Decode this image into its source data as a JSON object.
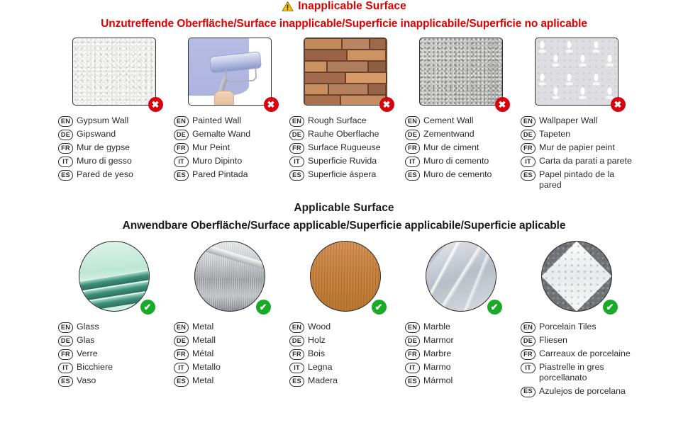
{
  "sections": {
    "inapplicable": {
      "title": "Inapplicable Surface",
      "subtitle": "Unzutreffende Oberfläche/Surface inapplicable/Superficie inapplicabile/Superficie no aplicable",
      "warning_icon": "warning-triangle-icon",
      "badge_symbol": "✖",
      "badge_color": "#d8000c",
      "title_color": "#e00000",
      "items": [
        {
          "media": "gypsum-wall-texture",
          "langs": [
            {
              "code": "EN",
              "text": "Gypsum Wall"
            },
            {
              "code": "DE",
              "text": "Gipswand"
            },
            {
              "code": "FR",
              "text": "Mur de gypse"
            },
            {
              "code": "IT",
              "text": "Muro di gesso"
            },
            {
              "code": "ES",
              "text": "Pared de yeso"
            }
          ]
        },
        {
          "media": "painted-wall-roller",
          "langs": [
            {
              "code": "EN",
              "text": "Painted Wall"
            },
            {
              "code": "DE",
              "text": "Gemalte Wand"
            },
            {
              "code": "FR",
              "text": "Mur Peint"
            },
            {
              "code": "IT",
              "text": "Muro Dipinto"
            },
            {
              "code": "ES",
              "text": "Pared Pintada"
            }
          ]
        },
        {
          "media": "rough-brick-surface",
          "langs": [
            {
              "code": "EN",
              "text": "Rough Surface"
            },
            {
              "code": "DE",
              "text": "Rauhe Oberflache"
            },
            {
              "code": "FR",
              "text": "Surface Rugueuse"
            },
            {
              "code": "IT",
              "text": "Superficie Ruvida"
            },
            {
              "code": "ES",
              "text": "Superficie áspera"
            }
          ]
        },
        {
          "media": "cement-wall-texture",
          "langs": [
            {
              "code": "EN",
              "text": "Cement Wall"
            },
            {
              "code": "DE",
              "text": "Zementwand"
            },
            {
              "code": "FR",
              "text": "Mur de ciment"
            },
            {
              "code": "IT",
              "text": "Muro di cemento"
            },
            {
              "code": "ES",
              "text": "Muro de cemento"
            }
          ]
        },
        {
          "media": "wallpaper-damask-texture",
          "langs": [
            {
              "code": "EN",
              "text": "Wallpaper Wall"
            },
            {
              "code": "DE",
              "text": "Tapeten"
            },
            {
              "code": "FR",
              "text": "Mur de papier peint"
            },
            {
              "code": "IT",
              "text": "Carta da parati a parete"
            },
            {
              "code": "ES",
              "text": "Papel pintado de la pared"
            }
          ]
        }
      ]
    },
    "applicable": {
      "title": "Applicable Surface",
      "subtitle": "Anwendbare Oberfläche/Surface applicable/Superficie applicabile/Superficie aplicable",
      "badge_symbol": "✔",
      "badge_color": "#17ab27",
      "title_color": "#1a1a1a",
      "items": [
        {
          "media": "glass-panes",
          "langs": [
            {
              "code": "EN",
              "text": "Glass"
            },
            {
              "code": "DE",
              "text": "Glas"
            },
            {
              "code": "FR",
              "text": "Verre"
            },
            {
              "code": "IT",
              "text": "Bicchiere"
            },
            {
              "code": "ES",
              "text": "Vaso"
            }
          ]
        },
        {
          "media": "brushed-metal",
          "langs": [
            {
              "code": "EN",
              "text": "Metal"
            },
            {
              "code": "DE",
              "text": "Metall"
            },
            {
              "code": "FR",
              "text": "Métal"
            },
            {
              "code": "IT",
              "text": "Metallo"
            },
            {
              "code": "ES",
              "text": "Metal"
            }
          ]
        },
        {
          "media": "wood-grain",
          "langs": [
            {
              "code": "EN",
              "text": "Wood"
            },
            {
              "code": "DE",
              "text": "Holz"
            },
            {
              "code": "FR",
              "text": "Bois"
            },
            {
              "code": "IT",
              "text": "Legna"
            },
            {
              "code": "ES",
              "text": "Madera"
            }
          ]
        },
        {
          "media": "marble-stone",
          "langs": [
            {
              "code": "EN",
              "text": "Marble"
            },
            {
              "code": "DE",
              "text": "Marmor"
            },
            {
              "code": "FR",
              "text": "Marbre"
            },
            {
              "code": "IT",
              "text": "Marmo"
            },
            {
              "code": "ES",
              "text": "Mármol"
            }
          ]
        },
        {
          "media": "porcelain-tile",
          "langs": [
            {
              "code": "EN",
              "text": "Porcelain Tiles"
            },
            {
              "code": "DE",
              "text": "Fliesen"
            },
            {
              "code": "FR",
              "text": "Carreaux de porcelaine"
            },
            {
              "code": "IT",
              "text": "Piastrelle in gres\nporcellanato"
            },
            {
              "code": "ES",
              "text": "Azulejos de porcelana"
            }
          ]
        }
      ]
    }
  }
}
